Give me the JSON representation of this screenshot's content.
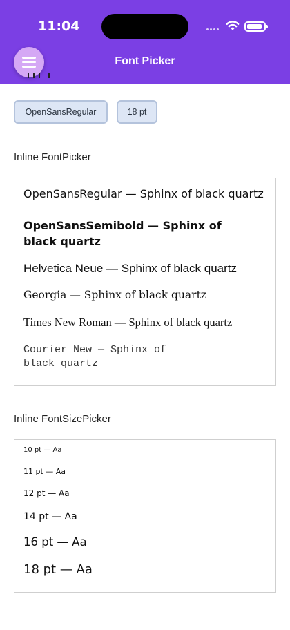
{
  "status_bar": {
    "time": "11:04"
  },
  "header": {
    "title": "Font Picker",
    "menu_icon": "hamburger-icon",
    "color": "#7b3fe4"
  },
  "selection": {
    "font_chip": "OpenSansRegular",
    "size_chip": "18 pt"
  },
  "font_picker": {
    "title": "Inline FontPicker",
    "items": [
      {
        "line1": "OpenSansRegular  —  Sphinx of black quartz"
      },
      {
        "line1": "OpenSansSemibold  —  Sphinx of",
        "line2": "black quartz"
      },
      {
        "line1": "Helvetica Neue  —  Sphinx of black quartz"
      },
      {
        "line1": "Georgia  —  Sphinx of black quartz"
      },
      {
        "line1": "Times New Roman  —  Sphinx of black quartz"
      },
      {
        "line1": "Courier New  —  Sphinx of",
        "line2": "black quartz"
      }
    ]
  },
  "size_picker": {
    "title": "Inline FontSizePicker",
    "items": [
      {
        "label": "10 pt — Aa"
      },
      {
        "label": "11 pt — Aa"
      },
      {
        "label": "12 pt — Aa"
      },
      {
        "label": "14 pt — Aa"
      },
      {
        "label": "16 pt — Aa"
      },
      {
        "label": "18 pt — Aa"
      }
    ]
  }
}
